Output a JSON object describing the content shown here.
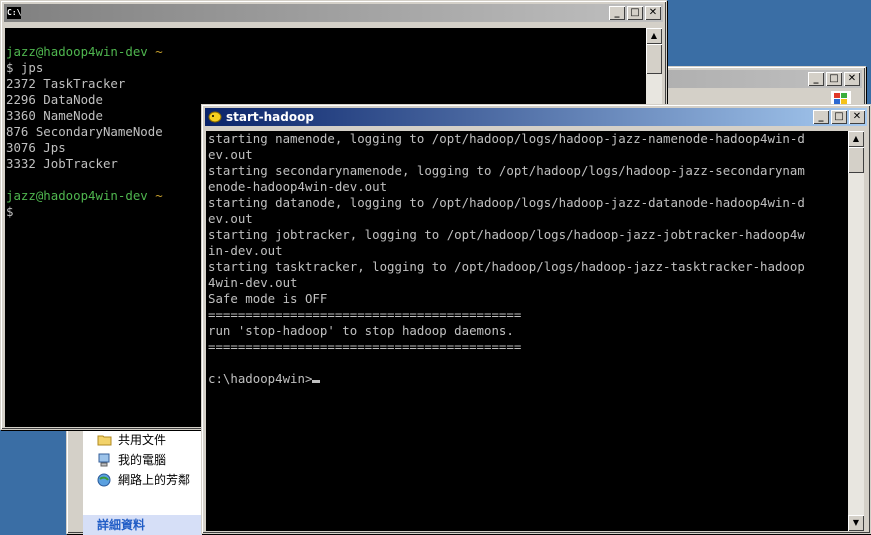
{
  "cygwin_window": {
    "title": "",
    "icon_label": "C:\\",
    "lines": [
      {
        "text": "",
        "style": "normal"
      },
      {
        "text": "jazz@hadoop4win-dev ~",
        "style": "prompt"
      },
      {
        "text": "$ jps",
        "style": "normal"
      },
      {
        "text": "2372 TaskTracker",
        "style": "normal"
      },
      {
        "text": "2296 DataNode",
        "style": "normal"
      },
      {
        "text": "3360 NameNode",
        "style": "normal"
      },
      {
        "text": "876 SecondaryNameNode",
        "style": "normal"
      },
      {
        "text": "3076 Jps",
        "style": "normal"
      },
      {
        "text": "3332 JobTracker",
        "style": "normal"
      },
      {
        "text": "",
        "style": "normal"
      },
      {
        "text": "jazz@hadoop4win-dev ~",
        "style": "prompt"
      },
      {
        "text": "$",
        "style": "normal"
      }
    ]
  },
  "explorer_window": {
    "items": [
      {
        "label": "共用文件",
        "icon": "folder-icon"
      },
      {
        "label": "我的電腦",
        "icon": "computer-icon"
      },
      {
        "label": "網路上的芳鄰",
        "icon": "network-icon"
      }
    ],
    "details_label": "詳細資料"
  },
  "start_hadoop_window": {
    "title": "start-hadoop",
    "lines": [
      "starting namenode, logging to /opt/hadoop/logs/hadoop-jazz-namenode-hadoop4win-d",
      "ev.out",
      "starting secondarynamenode, logging to /opt/hadoop/logs/hadoop-jazz-secondarynam",
      "enode-hadoop4win-dev.out",
      "starting datanode, logging to /opt/hadoop/logs/hadoop-jazz-datanode-hadoop4win-d",
      "ev.out",
      "starting jobtracker, logging to /opt/hadoop/logs/hadoop-jazz-jobtracker-hadoop4w",
      "in-dev.out",
      "starting tasktracker, logging to /opt/hadoop/logs/hadoop-jazz-tasktracker-hadoop",
      "4win-dev.out",
      "Safe mode is OFF",
      "==========================================",
      "run 'stop-hadoop' to stop hadoop daemons.",
      "==========================================",
      "",
      "c:\\hadoop4win>"
    ]
  },
  "window_buttons": {
    "minimize": "_",
    "maximize": "□",
    "close": "✕"
  }
}
